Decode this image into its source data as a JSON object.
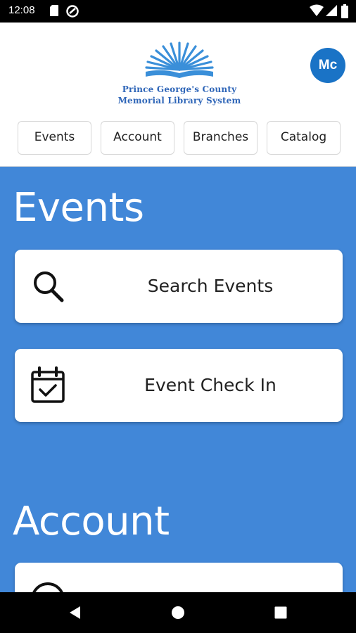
{
  "status_bar": {
    "time": "12:08",
    "icons": [
      "sd-card-icon",
      "data-saver-icon",
      "wifi-icon",
      "signal-icon",
      "battery-icon"
    ]
  },
  "header": {
    "logo": {
      "line1": "Prince George's County",
      "line2": "Memorial Library System",
      "color": "#2f66b8"
    },
    "avatar_initials": "Mc",
    "avatar_color": "#1a73c6"
  },
  "tabs": [
    {
      "label": "Events"
    },
    {
      "label": "Account"
    },
    {
      "label": "Branches"
    },
    {
      "label": "Catalog"
    }
  ],
  "sections": {
    "events": {
      "title": "Events",
      "cards": [
        {
          "label": "Search Events",
          "icon": "search-icon"
        },
        {
          "label": "Event Check In",
          "icon": "calendar-check-icon"
        }
      ]
    },
    "account": {
      "title": "Account"
    }
  },
  "nav_bar": {
    "buttons": [
      "back-icon",
      "home-icon",
      "recents-icon"
    ]
  },
  "colors": {
    "main_background": "#4187d8",
    "card_background": "#ffffff"
  }
}
